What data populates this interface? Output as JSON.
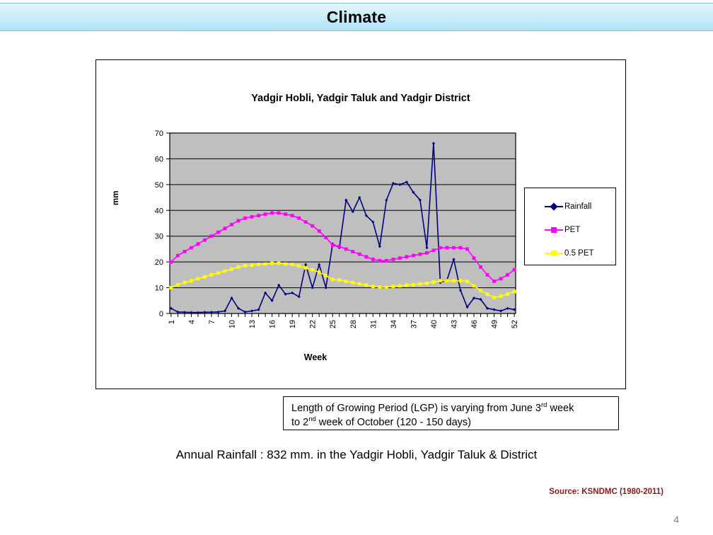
{
  "slide": {
    "banner_title": "Climate",
    "page_number": "4",
    "source_note": "Source: KSNDMC (1980-2011)",
    "annual_rainfall": "Annual Rainfall : 832 mm. in the Yadgir Hobli, Yadgir Taluk & District"
  },
  "lgp_box": {
    "line1_a": "Length of Growing Period (LGP) is varying from June 3",
    "line1_sup": "rd",
    "line1_b": " week",
    "line2_a": "to 2",
    "line2_sup": "nd",
    "line2_b": " week of October (120 - 150 days)"
  },
  "legend": {
    "items": [
      {
        "label": "Rainfall",
        "color": "#000080",
        "marker": "diamond"
      },
      {
        "label": "PET",
        "color": "#FF00FF",
        "marker": "square"
      },
      {
        "label": "0.5 PET",
        "color": "#FFFF00",
        "marker": "square"
      }
    ]
  },
  "colors": {
    "plot_background": "#BFBFBF",
    "gridline": "#000000",
    "rainfall": "#000080",
    "pet": "#FF00FF",
    "half_pet": "#FFFF00",
    "banner_border": "#7FC3CF",
    "source_text": "#8B1A18"
  },
  "chart_data": {
    "type": "line",
    "title": "Yadgir Hobli, Yadgir Taluk and Yadgir District",
    "xlabel": "Week",
    "ylabel": "mm",
    "ylim": [
      0,
      70
    ],
    "ytick_step": 10,
    "yticks": [
      0,
      10,
      20,
      30,
      40,
      50,
      60,
      70
    ],
    "grid": true,
    "legend_position": "right",
    "x": [
      1,
      2,
      3,
      4,
      5,
      6,
      7,
      8,
      9,
      10,
      11,
      12,
      13,
      14,
      15,
      16,
      17,
      18,
      19,
      20,
      21,
      22,
      23,
      24,
      25,
      26,
      27,
      28,
      29,
      30,
      31,
      32,
      33,
      34,
      35,
      36,
      37,
      38,
      39,
      40,
      41,
      42,
      43,
      44,
      45,
      46,
      47,
      48,
      49,
      50,
      51,
      52
    ],
    "xtick_labels": [
      "1",
      "4",
      "7",
      "10",
      "13",
      "16",
      "19",
      "22",
      "25",
      "28",
      "31",
      "34",
      "37",
      "40",
      "43",
      "46",
      "49",
      "52"
    ],
    "xtick_interval": 3,
    "series": [
      {
        "name": "Rainfall",
        "color": "#000080",
        "marker": "diamond",
        "values": [
          2.0,
          0.6,
          0.5,
          0.4,
          0.4,
          0.5,
          0.5,
          0.6,
          1.0,
          6.0,
          2.0,
          0.6,
          1.0,
          1.5,
          8.0,
          5.0,
          11.0,
          7.5,
          8.0,
          6.5,
          19.0,
          10.0,
          19.0,
          10.0,
          27.0,
          25.5,
          44.0,
          39.5,
          45.0,
          38.0,
          35.5,
          26.0,
          44.0,
          50.5,
          50.0,
          51.0,
          47.0,
          44.0,
          25.5,
          66.0,
          12.0,
          13.0,
          21.0,
          9.0,
          2.5,
          6.0,
          5.5,
          2.0,
          1.5,
          1.0,
          2.0,
          1.5
        ]
      },
      {
        "name": "PET",
        "color": "#FF00FF",
        "marker": "square",
        "values": [
          20.0,
          22.5,
          24.0,
          25.5,
          27.0,
          28.5,
          30.0,
          31.5,
          33.0,
          34.5,
          36.0,
          37.0,
          37.5,
          38.0,
          38.5,
          39.0,
          39.0,
          38.5,
          38.0,
          37.0,
          35.5,
          34.0,
          32.0,
          29.5,
          26.5,
          26.0,
          25.0,
          24.0,
          23.0,
          22.0,
          21.0,
          20.5,
          20.5,
          21.0,
          21.5,
          22.0,
          22.5,
          23.0,
          23.5,
          24.5,
          25.5,
          25.5,
          25.5,
          25.5,
          25.0,
          21.5,
          18.0,
          15.0,
          12.5,
          13.5,
          15.0,
          17.0
        ]
      },
      {
        "name": "0.5 PET",
        "color": "#FFFF00",
        "marker": "square",
        "values": [
          10.0,
          11.2,
          12.0,
          12.7,
          13.5,
          14.2,
          15.0,
          15.7,
          16.5,
          17.2,
          18.0,
          18.5,
          18.7,
          19.0,
          19.2,
          19.5,
          19.5,
          19.2,
          19.0,
          18.5,
          17.7,
          17.0,
          16.0,
          14.7,
          13.2,
          13.0,
          12.5,
          12.0,
          11.5,
          11.0,
          10.5,
          10.2,
          10.2,
          10.5,
          10.7,
          11.0,
          11.2,
          11.5,
          11.7,
          12.2,
          12.7,
          12.7,
          12.7,
          12.7,
          12.5,
          10.7,
          9.0,
          7.5,
          6.2,
          6.7,
          7.5,
          8.5
        ]
      }
    ]
  }
}
